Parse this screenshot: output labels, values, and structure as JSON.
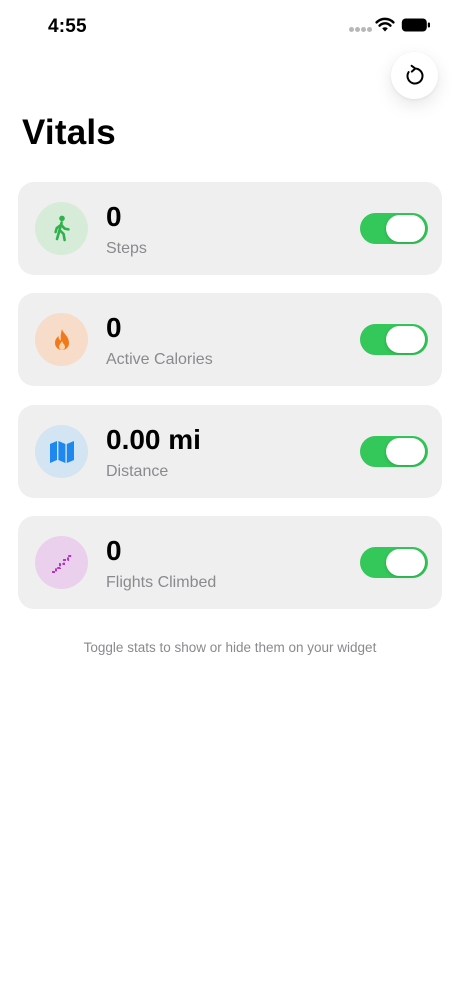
{
  "status_bar": {
    "time": "4:55",
    "icons": [
      "cellular-signal-icon",
      "wifi-icon",
      "battery-icon"
    ]
  },
  "header": {
    "refresh_icon": "refresh-icon"
  },
  "page": {
    "title": "Vitals"
  },
  "stats": [
    {
      "value": "0",
      "label": "Steps",
      "icon": "walking-icon",
      "icon_color": "#30b14c",
      "icon_bg": "#d6ecd9",
      "enabled": true
    },
    {
      "value": "0",
      "label": "Active Calories",
      "icon": "flame-icon",
      "icon_color": "#f07a1b",
      "icon_bg": "#f6dcc9",
      "enabled": true
    },
    {
      "value": "0.00 mi",
      "label": "Distance",
      "icon": "map-icon",
      "icon_color": "#1e88f0",
      "icon_bg": "#d3e4f3",
      "enabled": true
    },
    {
      "value": "0",
      "label": "Flights Climbed",
      "icon": "stairs-icon",
      "icon_color": "#b138c4",
      "icon_bg": "#ead0ec",
      "enabled": true
    }
  ],
  "footer": {
    "hint": "Toggle stats to show or hide them on your widget"
  },
  "colors": {
    "toggle_on": "#34c759",
    "card_background": "#efefef",
    "secondary_text": "#8a8a8e"
  }
}
